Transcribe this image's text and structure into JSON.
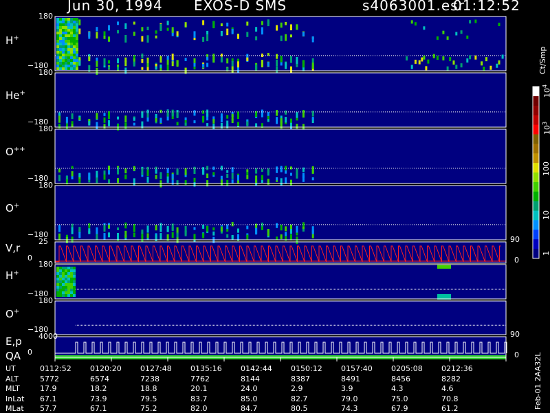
{
  "header": {
    "date": "Jun 30, 1994",
    "instrument": "EXOS-D SMS",
    "file": "s4063001.esr",
    "time": "01:12:52"
  },
  "panels": [
    {
      "species": "H",
      "charge": "+",
      "top": "180",
      "bottom": "−180"
    },
    {
      "species": "He",
      "charge": "+",
      "top": "180",
      "bottom": "−180"
    },
    {
      "species": "O",
      "charge": "++",
      "top": "180",
      "bottom": "−180"
    },
    {
      "species": "O",
      "charge": "+",
      "top": "180",
      "bottom": "−180"
    },
    {
      "species": "V,r",
      "charge": "",
      "top": "25",
      "bottom": "0"
    },
    {
      "species": "H",
      "charge": "+",
      "top": "180",
      "bottom": "−180"
    },
    {
      "species": "O",
      "charge": "+",
      "top": "180",
      "bottom": "−180"
    },
    {
      "species": "E,p",
      "charge": "",
      "top": "4000",
      "bottom": "0"
    }
  ],
  "qa_label": "QA",
  "right_axis": {
    "r1_top": "90",
    "r1_bottom": "0",
    "r2_top": "90",
    "r2_bottom": "0"
  },
  "colorbar": {
    "unit": "Ct/Smp",
    "ticks": [
      "1",
      "10",
      "100",
      "10",
      "10"
    ],
    "tick_exps": [
      "",
      "",
      "",
      "3",
      "4"
    ],
    "colors": [
      "#000080",
      "#0000c0",
      "#0040ff",
      "#0090ff",
      "#00c0c0",
      "#00a070",
      "#00b000",
      "#40d000",
      "#90e000",
      "#e0e000",
      "#c09000",
      "#a07000",
      "#806000",
      "#ff0000",
      "#c00000",
      "#900000",
      "#700000",
      "#ffffff"
    ]
  },
  "footer": {
    "side_label": "Feb-01 2AA32L",
    "rows": [
      {
        "label": "UT",
        "values": [
          "0112:52",
          "0120:20",
          "0127:48",
          "0135:16",
          "0142:44",
          "0150:12",
          "0157:40",
          "0205:08",
          "0212:36"
        ]
      },
      {
        "label": "ALT",
        "values": [
          "5772",
          "6574",
          "7238",
          "7762",
          "8144",
          "8387",
          "8491",
          "8456",
          "8282"
        ]
      },
      {
        "label": "MLT",
        "values": [
          "17.9",
          "18.2",
          "18.8",
          "20.1",
          "24.0",
          "2.9",
          "3.9",
          "4.3",
          "4.6"
        ]
      },
      {
        "label": "InLat",
        "values": [
          "67.1",
          "73.9",
          "79.5",
          "83.7",
          "85.0",
          "82.7",
          "79.0",
          "75.0",
          "70.8"
        ]
      },
      {
        "label": "MLat",
        "values": [
          "57.7",
          "67.1",
          "75.2",
          "82.0",
          "84.7",
          "80.5",
          "74.3",
          "67.9",
          "61.2"
        ]
      }
    ]
  },
  "chart_data": {
    "type": "heatmap",
    "title": "Jun 30, 1994   EXOS-D SMS",
    "x_ticks": [
      "0112:52",
      "0120:20",
      "0127:48",
      "0135:16",
      "0142:44",
      "0150:12",
      "0157:40",
      "0205:08",
      "0212:36"
    ],
    "panels": [
      "H+",
      "He+",
      "O++",
      "O+",
      "V,r",
      "H+",
      "O+",
      "E,p"
    ],
    "ylim_pitch": [
      -180,
      180
    ],
    "ylim_vr": [
      0,
      25
    ],
    "ylim_ep": [
      0,
      4000
    ],
    "colorbar_range": [
      1,
      10000
    ],
    "colorbar_scale": "log",
    "colorbar_unit": "Ct/Smp"
  }
}
